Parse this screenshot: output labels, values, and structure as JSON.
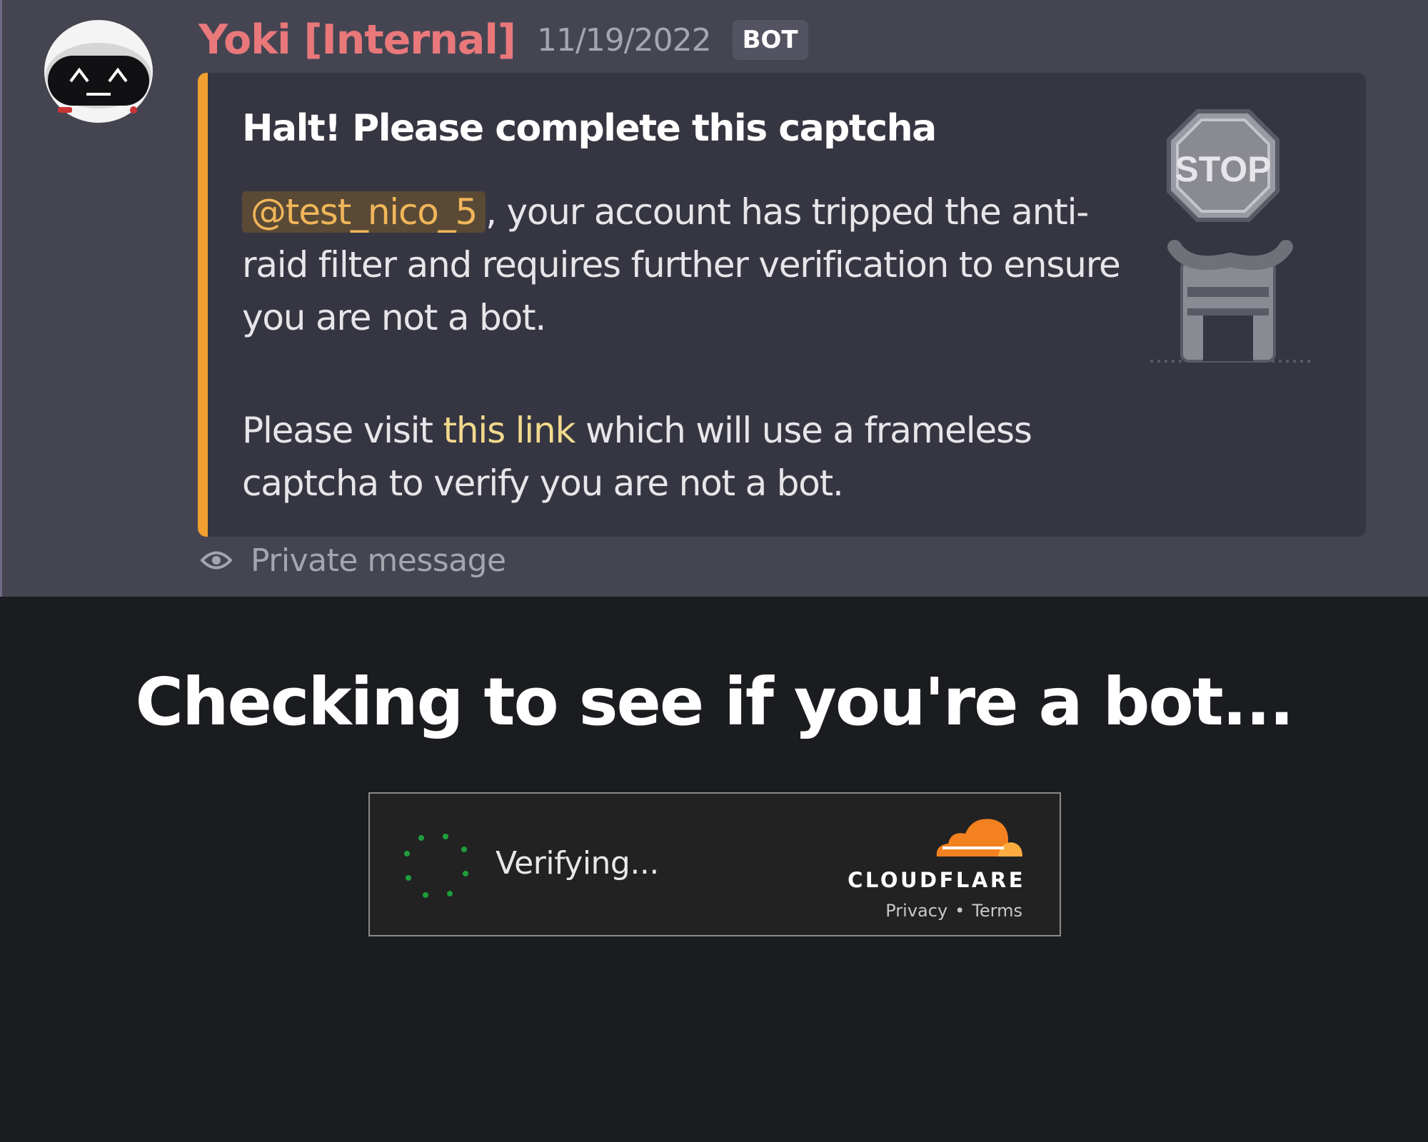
{
  "message": {
    "author": "Yoki [Internal]",
    "timestamp": "11/19/2022",
    "badge": "BOT",
    "embed": {
      "accent_color": "#f1a02f",
      "title": "Halt! Please complete this captcha",
      "mention": "@test_nico_5",
      "desc_after_mention": ", your account has tripped the anti-raid filter and requires further verification to ensure you are not a bot.",
      "line2_prefix": "Please visit ",
      "link_text": "this link",
      "line2_suffix": " which will use a frameless captcha to verify you are not a bot.",
      "thumbnail_text": "STOP",
      "thumbnail_icon": "stop-sign-robot"
    },
    "footer_text": "Private message",
    "footer_icon": "eye-icon"
  },
  "cloudflare": {
    "heading": "Checking to see if you're a bot...",
    "status": "Verifying...",
    "brand": "CLOUDFLARE",
    "privacy": "Privacy",
    "separator": "•",
    "terms": "Terms",
    "spinner_color": "#1e9e3a",
    "brand_color": "#f48120"
  }
}
